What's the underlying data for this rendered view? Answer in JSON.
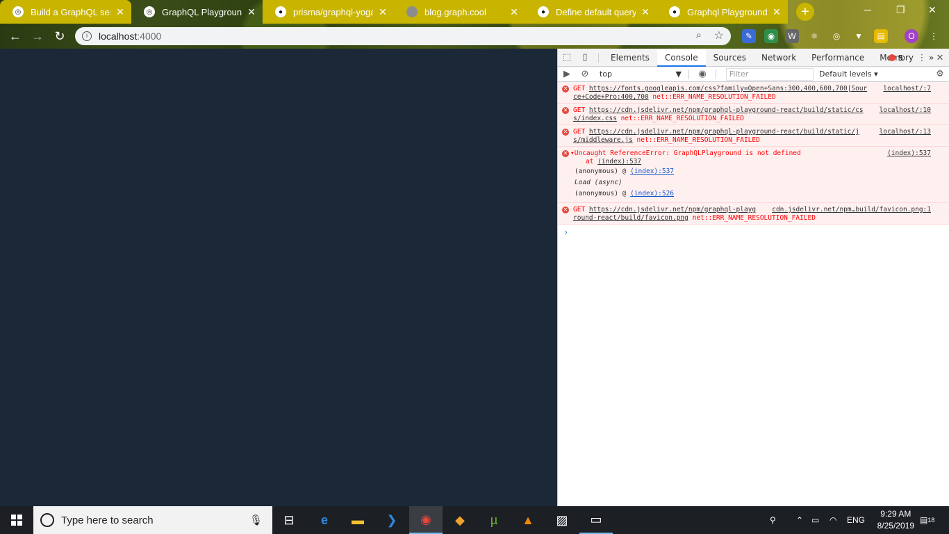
{
  "browser": {
    "tabs": [
      {
        "title": "Build a GraphQL server",
        "icon": "globe-icon",
        "active": false
      },
      {
        "title": "GraphQL Playground",
        "icon": "globe-icon",
        "active": true
      },
      {
        "title": "prisma/graphql-yoga: G",
        "icon": "github-icon",
        "active": false
      },
      {
        "title": "blog.graph.cool",
        "icon": "globe-icon",
        "active": false
      },
      {
        "title": "Define default query sh",
        "icon": "github-icon",
        "active": false
      },
      {
        "title": "Graphql Playground en",
        "icon": "github-icon",
        "active": false
      }
    ],
    "address": {
      "host": "localhost",
      "port": ":4000"
    }
  },
  "devtools": {
    "tabs": [
      "Elements",
      "Console",
      "Sources",
      "Network",
      "Performance",
      "Memory"
    ],
    "active_tab": "Console",
    "more_tabs": "»",
    "error_count": "5",
    "context": "top",
    "filter_placeholder": "Filter",
    "levels": "Default levels ▾",
    "messages": [
      {
        "prefix": "GET",
        "url": "https://fonts.googleapis.com/css?family=Open+Sans:300,400,600,700|Source+Code+Pro:400,700",
        "url_line1": "https://fonts.googleapis.com/css?family=Open+Sans:300,400,600,700|Sour",
        "url_line2": "ce+Code+Pro:400,700",
        "error": "net::ERR_NAME_RESOLUTION_FAILED",
        "source": "localhost/:7"
      },
      {
        "prefix": "GET",
        "url_line1": "https://cdn.jsdelivr.net/npm/graphql-playground-react/build/static/cs",
        "url_line2": "s/index.css",
        "error": "net::ERR_NAME_RESOLUTION_FAILED",
        "source": "localhost/:10"
      },
      {
        "prefix": "GET",
        "url_line1": "https://cdn.jsdelivr.net/npm/graphql-playground-react/build/static/j",
        "url_line2": "s/middleware.js",
        "error": "net::ERR_NAME_RESOLUTION_FAILED",
        "source": "localhost/:13"
      },
      {
        "text": "▾Uncaught ReferenceError: GraphQLPlayground is not defined",
        "at": "at",
        "at_link": "(index):537",
        "stack": [
          {
            "fn": "(anonymous) @",
            "link": "(index):537"
          },
          {
            "fn": "Load (async)",
            "link": ""
          },
          {
            "fn": "(anonymous) @",
            "link": "(index):526"
          }
        ],
        "source": "(index):537"
      },
      {
        "prefix": "GET",
        "url_line1": "https://cdn.jsdelivr.net/npm/graphql-playg",
        "url_line2": "round-react/build/favicon.png",
        "error": "net::ERR_NAME_RESOLUTION_FAILED",
        "source": "cdn.jsdelivr.net/npm…build/favicon.png:1"
      }
    ],
    "prompt": "›"
  },
  "taskbar": {
    "search_placeholder": "Type here to search",
    "language": "ENG",
    "time": "9:29 AM",
    "date": "8/25/2019",
    "notifications": "18"
  },
  "colors": {
    "page_bg": "#1b2838",
    "tab_bg": "#c9b400",
    "error_red": "#ff0000"
  }
}
